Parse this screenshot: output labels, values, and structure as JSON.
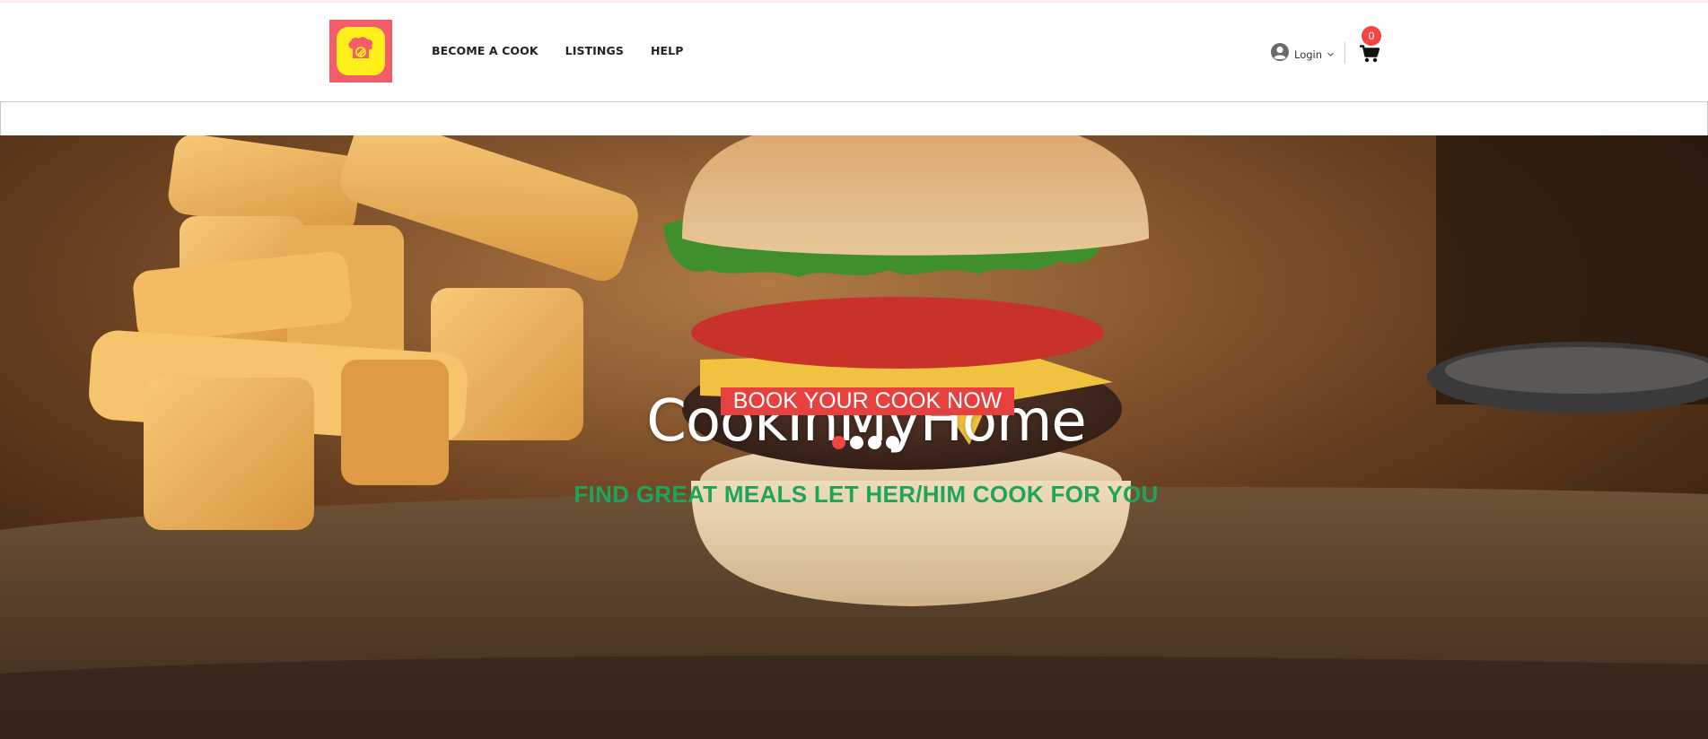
{
  "brand": {
    "name": "CookInMyHome",
    "logo_icon": "chef-hat-icon",
    "colors": {
      "logo_bg": "#f35d6b",
      "logo_inner": "#ffef1a"
    }
  },
  "nav": {
    "items": [
      {
        "label": "BECOME A COOK"
      },
      {
        "label": "LISTINGS"
      },
      {
        "label": "HELP"
      }
    ]
  },
  "account": {
    "login_label": "Login",
    "icon": "user-icon",
    "chevron": "chevron-down-icon"
  },
  "cart": {
    "count": "0",
    "icon": "shopping-cart-icon",
    "badge_color": "#f04545"
  },
  "hero": {
    "title": "CookInMyHome",
    "tagline": "FIND GREAT MEALS LET HER/HIM COOK FOR YOU",
    "cta_label": "BOOK YOUR COOK NOW",
    "slides": 4,
    "active_slide": 1,
    "colors": {
      "tagline": "#1fa55a",
      "cta_bg": "#e7413f",
      "active_dot": "#f04545"
    }
  }
}
